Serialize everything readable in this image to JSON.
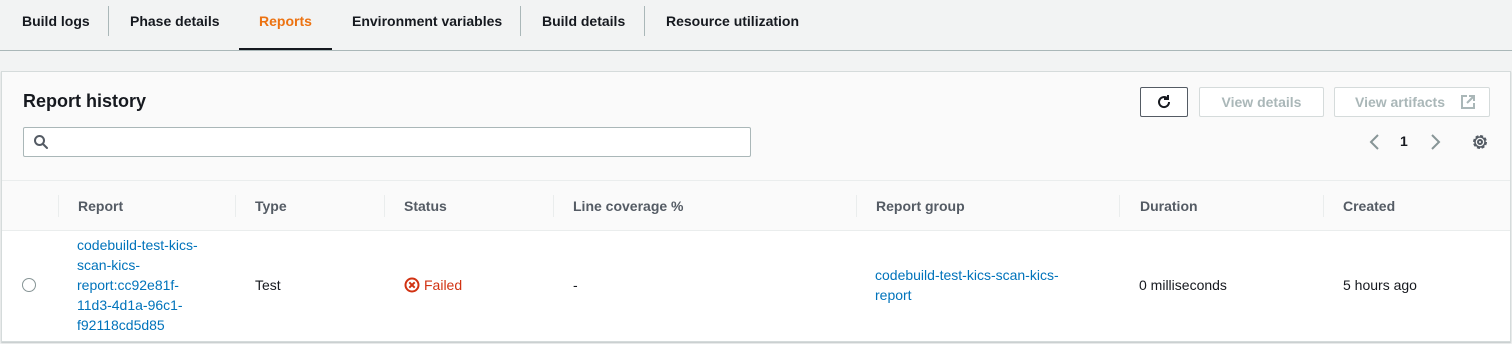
{
  "tabs": [
    {
      "label": "Build logs",
      "active": false
    },
    {
      "label": "Phase details",
      "active": false
    },
    {
      "label": "Reports",
      "active": true
    },
    {
      "label": "Environment variables",
      "active": false
    },
    {
      "label": "Build details",
      "active": false
    },
    {
      "label": "Resource utilization",
      "active": false
    }
  ],
  "panel": {
    "title": "Report history",
    "search": {
      "value": "",
      "placeholder": ""
    },
    "buttons": {
      "refresh_icon": "refresh-icon",
      "view_details": "View details",
      "view_artifacts": "View artifacts",
      "view_artifacts_icon": "external-link-icon"
    },
    "pagination": {
      "current_page": "1"
    },
    "settings_icon": "gear-icon"
  },
  "table": {
    "columns": [
      "Report",
      "Type",
      "Status",
      "Line coverage %",
      "Report group",
      "Duration",
      "Created"
    ],
    "rows": [
      {
        "selected": false,
        "report_lines": [
          "codebuild-test-kics-",
          "scan-kics-",
          "report:cc92e81f-",
          "11d3-4d1a-96c1-",
          "f92118cd5d85"
        ],
        "type": "Test",
        "status": "Failed",
        "status_icon": "failed-x-icon",
        "line_coverage": "-",
        "report_group_lines": [
          "codebuild-test-kics-scan-kics-",
          "report"
        ],
        "duration": "0 milliseconds",
        "created": "5 hours ago"
      }
    ]
  },
  "colors": {
    "accent_active_tab": "#ec7211",
    "link": "#0073bb",
    "error": "#d13212"
  }
}
